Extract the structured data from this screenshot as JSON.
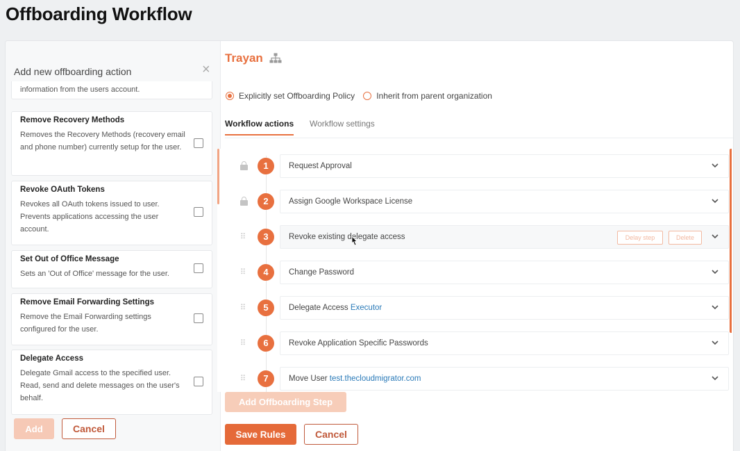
{
  "page": {
    "title": "Offboarding Workflow"
  },
  "left_panel": {
    "header": "Add new offboarding action",
    "close_glyph": "×",
    "partial_item_text": "information from the users account.",
    "actions": [
      {
        "title": "Remove Recovery Methods",
        "desc": "Removes the Recovery Methods (recovery email and phone number) currently setup for the user."
      },
      {
        "title": "Revoke OAuth Tokens",
        "desc": "Revokes all OAuth tokens issued to user. Prevents applications accessing the user account."
      },
      {
        "title": "Set Out of Office Message",
        "desc": "Sets an 'Out of Office' message for the user."
      },
      {
        "title": "Remove Email Forwarding Settings",
        "desc": "Remove the Email Forwarding settings configured for the user."
      },
      {
        "title": "Delegate Access",
        "desc": "Delegate Gmail access to the specified user. Read, send and delete messages on the user's behalf."
      }
    ],
    "add_label": "Add",
    "cancel_label": "Cancel"
  },
  "org": {
    "name": "Trayan",
    "icon": "org-chart-icon"
  },
  "policy": {
    "options": [
      {
        "label": "Explicitly set Offboarding Policy",
        "selected": true
      },
      {
        "label": "Inherit from parent organization",
        "selected": false
      }
    ]
  },
  "tabs": [
    {
      "label": "Workflow actions",
      "active": true
    },
    {
      "label": "Workflow settings",
      "active": false
    }
  ],
  "steps": [
    {
      "num": "1",
      "label": "Request Approval",
      "link": "",
      "locked": true
    },
    {
      "num": "2",
      "label": "Assign Google Workspace License",
      "link": "",
      "locked": true
    },
    {
      "num": "3",
      "label": "Revoke existing delegate access",
      "link": "",
      "locked": false
    },
    {
      "num": "4",
      "label": "Change Password",
      "link": "",
      "locked": false
    },
    {
      "num": "5",
      "label": "Delegate Access ",
      "link": "Executor",
      "locked": false
    },
    {
      "num": "6",
      "label": "Revoke Application Specific Passwords",
      "link": "",
      "locked": false
    },
    {
      "num": "7",
      "label": "Move User ",
      "link": "test.thecloudmigrator.com",
      "locked": false
    }
  ],
  "step_actions": {
    "delay_label": "Delay step",
    "delete_label": "Delete"
  },
  "buttons": {
    "add_step": "Add Offboarding Step",
    "save": "Save Rules",
    "cancel": "Cancel"
  },
  "colors": {
    "accent": "#e8703f",
    "link": "#2a7ab8"
  }
}
